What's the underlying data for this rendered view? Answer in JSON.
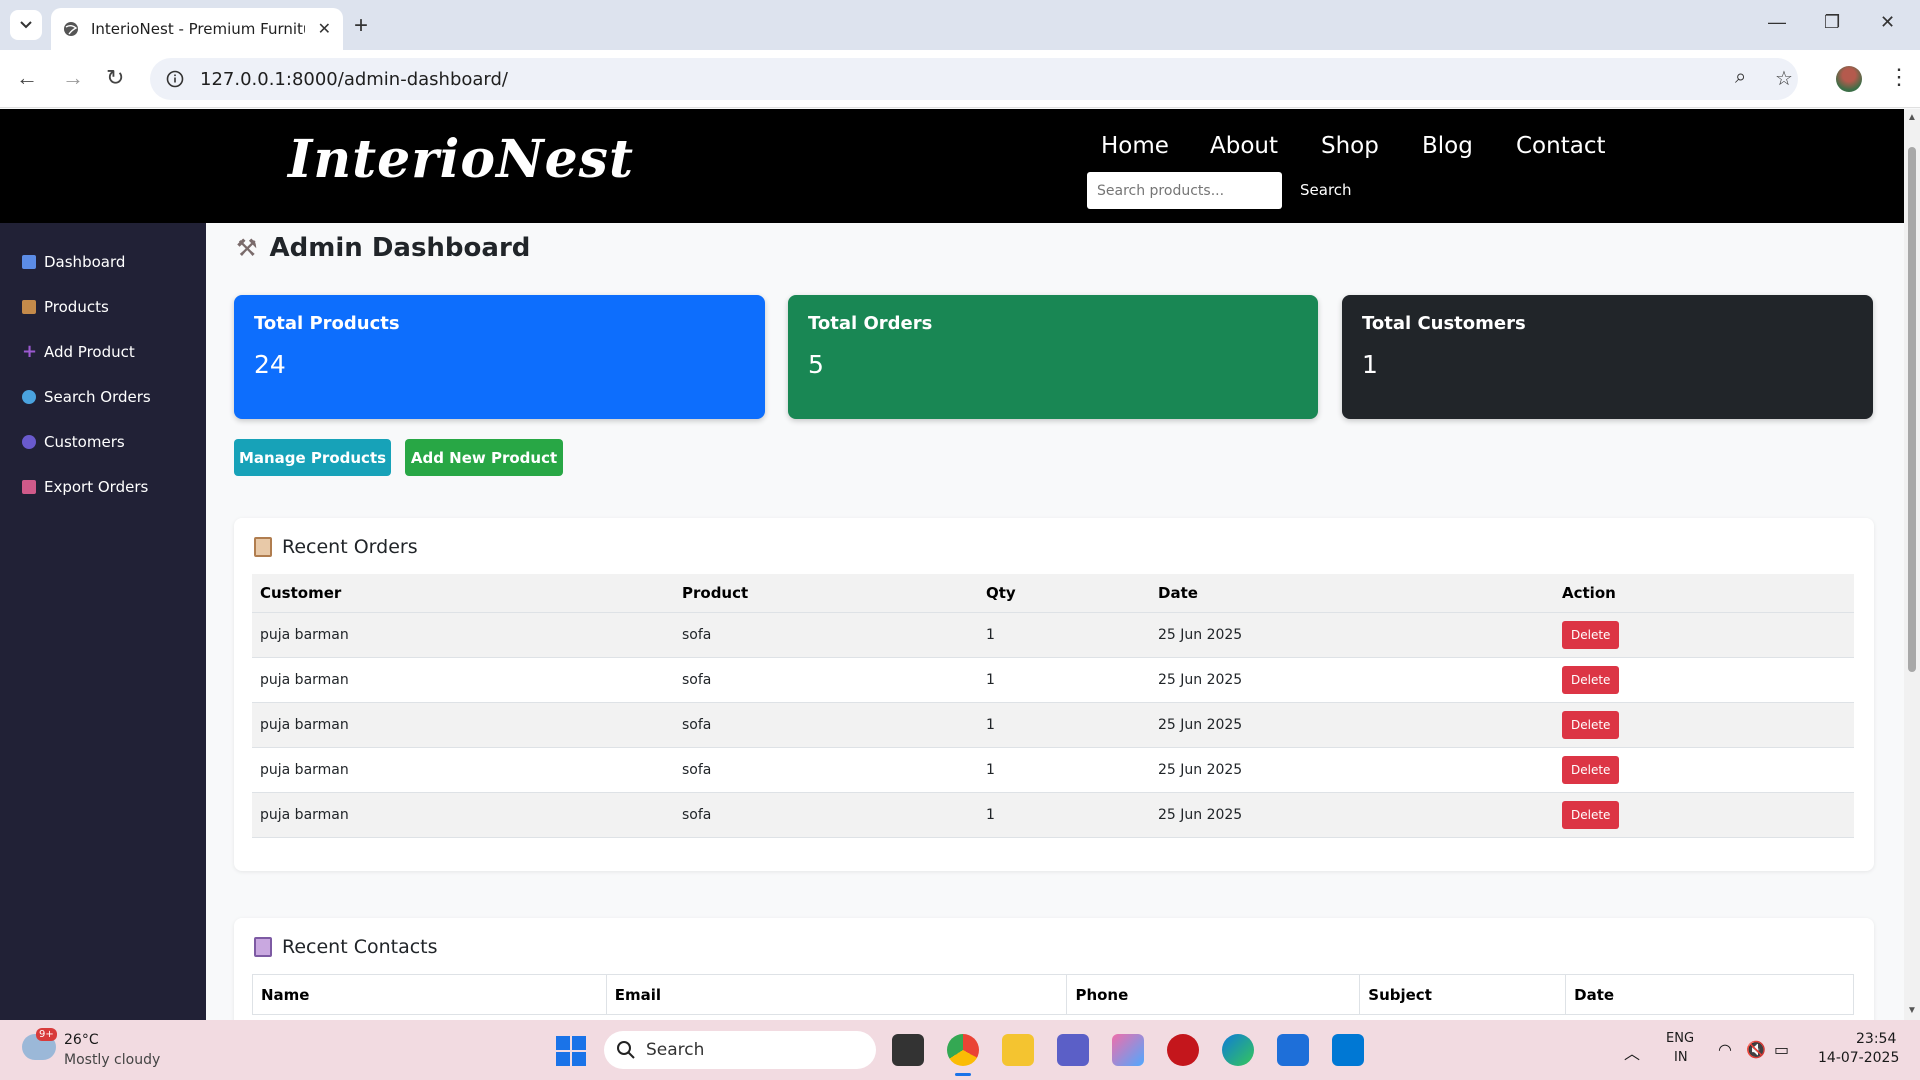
{
  "browser": {
    "tab_title": "InterioNest - Premium Furniture",
    "url": "127.0.0.1:8000/admin-dashboard/"
  },
  "site": {
    "logo": "InterioNest",
    "nav": [
      "Home",
      "About",
      "Shop",
      "Blog",
      "Contact"
    ],
    "search_placeholder": "Search products...",
    "search_button": "Search"
  },
  "sidebar": {
    "items": [
      {
        "label": "Dashboard",
        "icon": "bar-chart-icon",
        "color": "#5c8ce6"
      },
      {
        "label": "Products",
        "icon": "package-icon",
        "color": "#c48a4a"
      },
      {
        "label": "Add Product",
        "icon": "plus-icon",
        "color": "#9b59d0"
      },
      {
        "label": "Search Orders",
        "icon": "magnifier-icon",
        "color": "#4aa3df"
      },
      {
        "label": "Customers",
        "icon": "people-icon",
        "color": "#6a5acd"
      },
      {
        "label": "Export Orders",
        "icon": "outbox-icon",
        "color": "#d05a8a"
      }
    ]
  },
  "dashboard": {
    "title": "Admin Dashboard",
    "title_icon": "tools-icon",
    "cards": [
      {
        "label": "Total Products",
        "value": "24",
        "color": "#0d6efd"
      },
      {
        "label": "Total Orders",
        "value": "5",
        "color": "#198754"
      },
      {
        "label": "Total Customers",
        "value": "1",
        "color": "#212529"
      }
    ],
    "buttons": {
      "manage": "Manage Products",
      "add": "Add New Product"
    }
  },
  "orders": {
    "title": "Recent Orders",
    "columns": [
      "Customer",
      "Product",
      "Qty",
      "Date",
      "Action"
    ],
    "rows": [
      {
        "customer": "puja barman",
        "product": "sofa",
        "qty": "1",
        "date": "25 Jun 2025",
        "action": "Delete"
      },
      {
        "customer": "puja barman",
        "product": "sofa",
        "qty": "1",
        "date": "25 Jun 2025",
        "action": "Delete"
      },
      {
        "customer": "puja barman",
        "product": "sofa",
        "qty": "1",
        "date": "25 Jun 2025",
        "action": "Delete"
      },
      {
        "customer": "puja barman",
        "product": "sofa",
        "qty": "1",
        "date": "25 Jun 2025",
        "action": "Delete"
      },
      {
        "customer": "puja barman",
        "product": "sofa",
        "qty": "1",
        "date": "25 Jun 2025",
        "action": "Delete"
      }
    ]
  },
  "contacts": {
    "title": "Recent Contacts",
    "columns": [
      "Name",
      "Email",
      "Phone",
      "Subject",
      "Date"
    ]
  },
  "taskbar": {
    "weather_badge": "9+",
    "temperature": "26°C",
    "weather": "Mostly cloudy",
    "search": "Search",
    "lang_1": "ENG",
    "lang_2": "IN",
    "time": "23:54",
    "date": "14-07-2025"
  }
}
